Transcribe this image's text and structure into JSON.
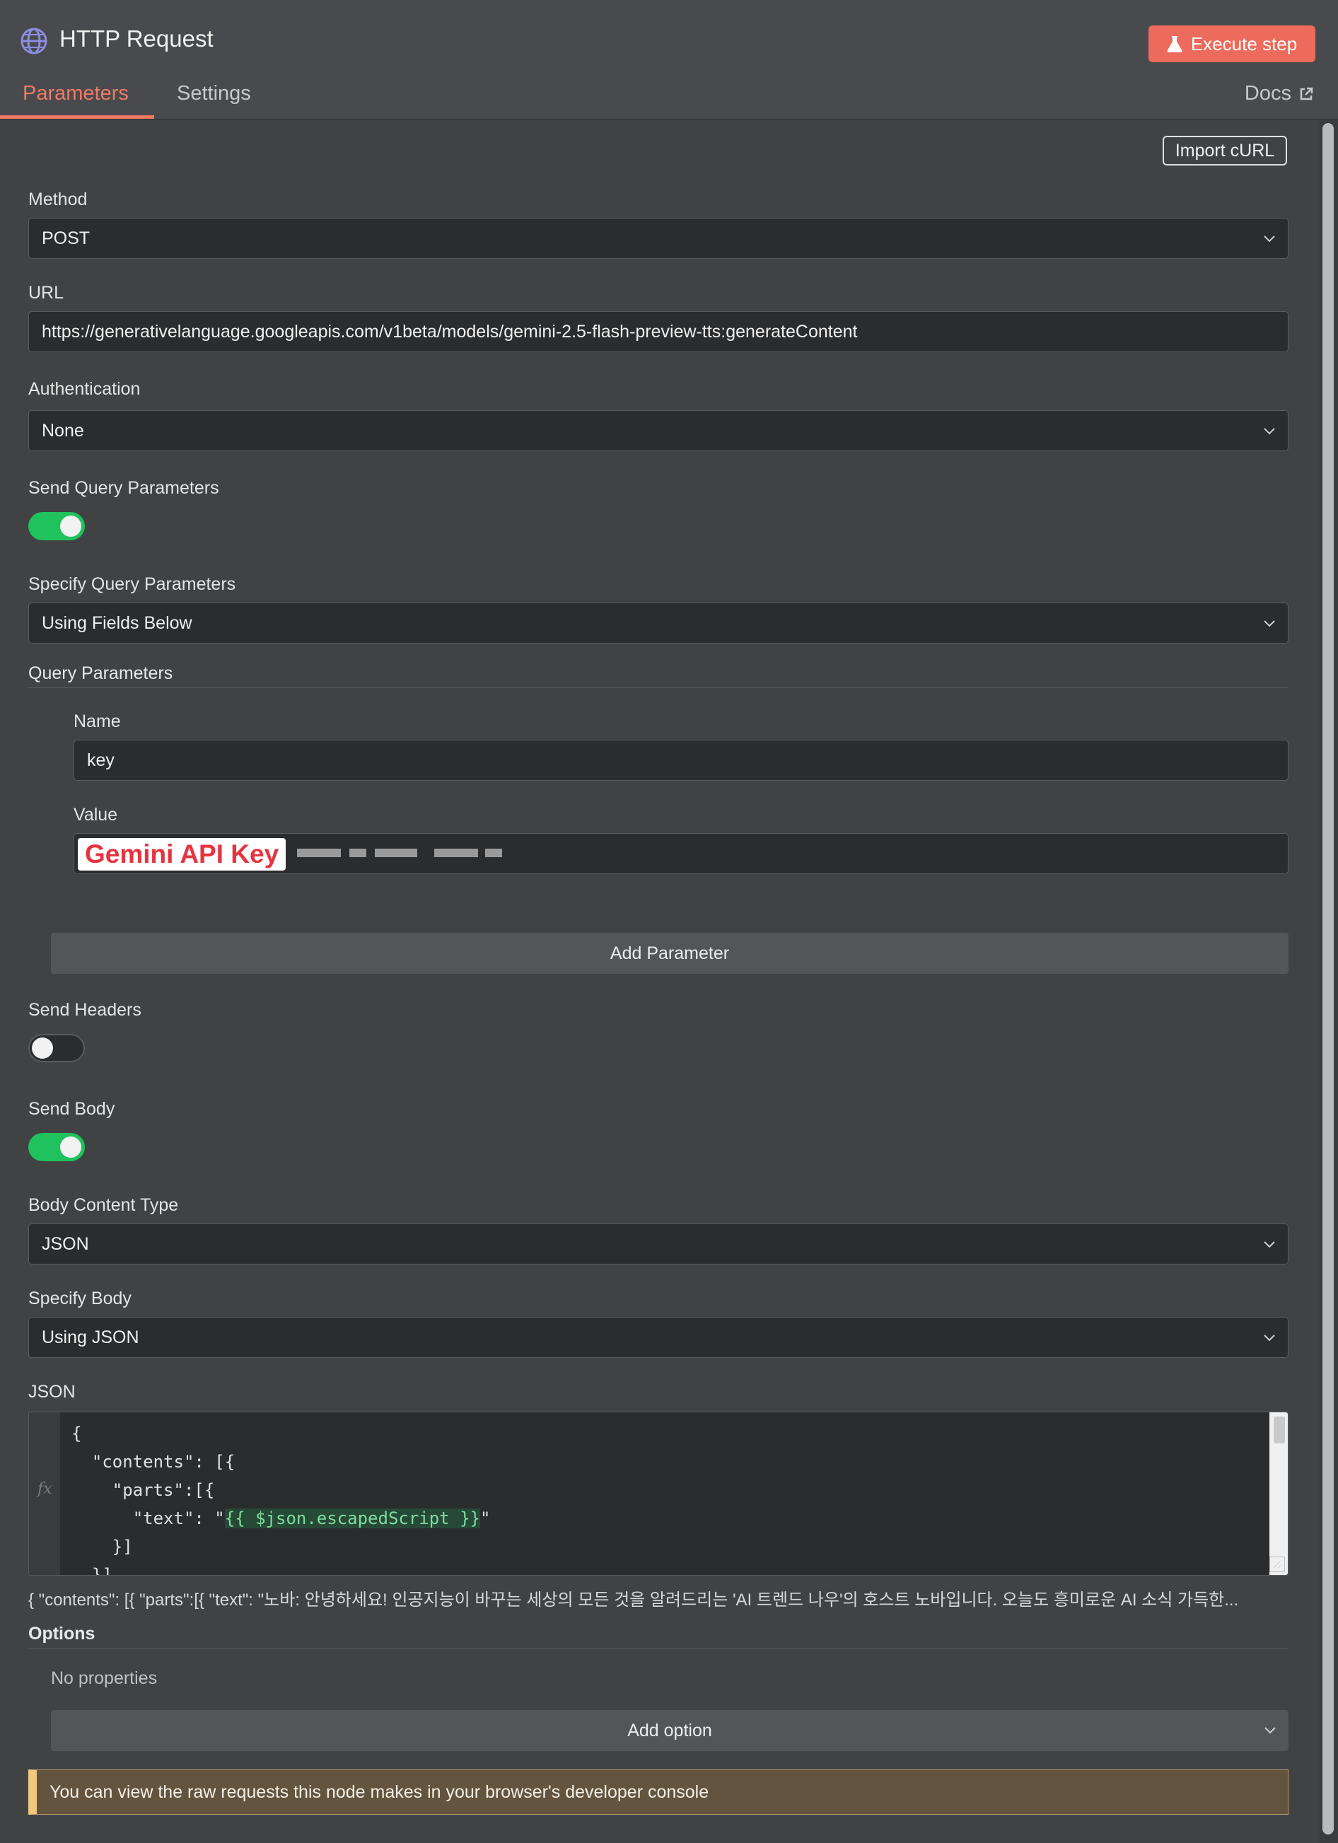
{
  "header": {
    "title": "HTTP Request",
    "execute_label": "Execute step",
    "tabs": [
      "Parameters",
      "Settings"
    ],
    "active_tab": "Parameters",
    "docs_label": "Docs",
    "accent_color": "#ef7a64"
  },
  "import_curl_label": "Import cURL",
  "method": {
    "label": "Method",
    "value": "POST"
  },
  "url": {
    "label": "URL",
    "value": "https://generativelanguage.googleapis.com/v1beta/models/gemini-2.5-flash-preview-tts:generateContent"
  },
  "authentication": {
    "label": "Authentication",
    "value": "None"
  },
  "send_query": {
    "label": "Send Query Parameters",
    "on": true
  },
  "specify_query": {
    "label": "Specify Query Parameters",
    "value": "Using Fields Below"
  },
  "query_parameters": {
    "title": "Query Parameters",
    "name_label": "Name",
    "name_value": "key",
    "value_label": "Value",
    "value_annotation": "Gemini API Key",
    "add_label": "Add Parameter"
  },
  "send_headers": {
    "label": "Send Headers",
    "on": false
  },
  "send_body": {
    "label": "Send Body",
    "on": true
  },
  "body_content_type": {
    "label": "Body Content Type",
    "value": "JSON"
  },
  "specify_body": {
    "label": "Specify Body",
    "value": "Using JSON"
  },
  "json_editor": {
    "label": "JSON",
    "lines": [
      "{",
      "  \"contents\": [{",
      "    \"parts\":[{",
      "      \"text\": \"",
      "    }]",
      "  }]"
    ],
    "expression": "{{ $json.escapedScript }}",
    "preview": "{   \"contents\": [{     \"parts\":[{       \"text\": \"노바: 안녕하세요! 인공지능이 바꾸는 세상의 모든 것을 알려드리는 'AI 트렌드 나우'의 호스트 노바입니다. 오늘도 흥미로운 AI 소식 가득한..."
  },
  "options": {
    "title": "Options",
    "empty_text": "No properties",
    "add_label": "Add option"
  },
  "info_message": "You can view the raw requests this node makes in your browser's developer console"
}
